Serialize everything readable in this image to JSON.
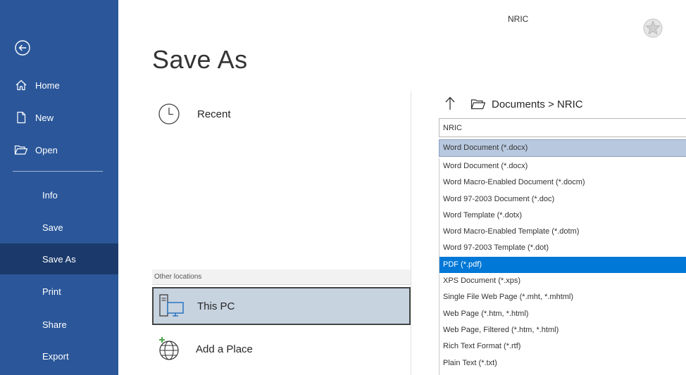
{
  "window": {
    "title": "NRIC"
  },
  "sidebar": {
    "items": [
      {
        "label": "Home",
        "icon": "home-icon"
      },
      {
        "label": "New",
        "icon": "new-document-icon"
      },
      {
        "label": "Open",
        "icon": "open-folder-icon"
      }
    ],
    "sub_items": [
      {
        "label": "Info"
      },
      {
        "label": "Save"
      },
      {
        "label": "Save As"
      },
      {
        "label": "Print"
      },
      {
        "label": "Share"
      },
      {
        "label": "Export"
      }
    ],
    "active": "Save As",
    "color": "#2b579a",
    "active_color": "#1b3a6b"
  },
  "page": {
    "title": "Save As"
  },
  "locations": {
    "recent_label": "Recent",
    "other_locations_header": "Other locations",
    "this_pc_label": "This PC",
    "add_place_label": "Add a Place"
  },
  "save_panel": {
    "breadcrumb": "Documents > NRIC",
    "filename_value": "NRIC",
    "selected_file_type": "Word Document (*.docx)",
    "file_type_options": [
      "Word Document (*.docx)",
      "Word Macro-Enabled Document (*.docm)",
      "Word 97-2003 Document (*.doc)",
      "Word Template (*.dotx)",
      "Word Macro-Enabled Template (*.dotm)",
      "Word 97-2003 Template (*.dot)",
      "PDF (*.pdf)",
      "XPS Document (*.xps)",
      "Single File Web Page (*.mht, *.mhtml)",
      "Web Page (*.htm, *.html)",
      "Web Page, Filtered (*.htm, *.html)",
      "Rich Text Format (*.rtf)",
      "Plain Text (*.txt)"
    ],
    "highlighted_option": "PDF (*.pdf)",
    "highlight_color": "#0078d7"
  }
}
